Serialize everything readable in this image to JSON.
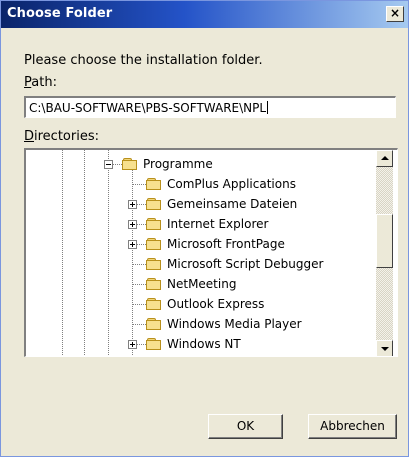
{
  "window": {
    "title": "Choose Folder",
    "close_glyph": "×"
  },
  "prompt": "Please choose the installation folder.",
  "path": {
    "label_accel": "P",
    "label_rest": "ath:",
    "value": "C:\\BAU-SOFTWARE\\PBS-SOFTWARE\\NPL"
  },
  "directories": {
    "label_accel": "D",
    "label_rest": "irectories:",
    "items": [
      {
        "label": "Programme",
        "expander": "minus"
      },
      {
        "label": "ComPlus Applications",
        "expander": "none"
      },
      {
        "label": "Gemeinsame Dateien",
        "expander": "plus"
      },
      {
        "label": "Internet Explorer",
        "expander": "plus"
      },
      {
        "label": "Microsoft FrontPage",
        "expander": "plus"
      },
      {
        "label": "Microsoft Script Debugger",
        "expander": "none"
      },
      {
        "label": "NetMeeting",
        "expander": "none"
      },
      {
        "label": "Outlook Express",
        "expander": "none"
      },
      {
        "label": "Windows Media Player",
        "expander": "none"
      },
      {
        "label": "Windows NT",
        "expander": "plus"
      }
    ]
  },
  "buttons": {
    "ok": "OK",
    "cancel": "Abbrechen"
  },
  "icons": {
    "folder": "folder-icon",
    "close": "close-icon",
    "scroll_up": "scroll-up-arrow-icon",
    "scroll_down": "scroll-down-arrow-icon"
  },
  "colors": {
    "title_bar": "#0a246a",
    "dialog_bg": "#ece9d8",
    "folder": "#f7e08e"
  }
}
